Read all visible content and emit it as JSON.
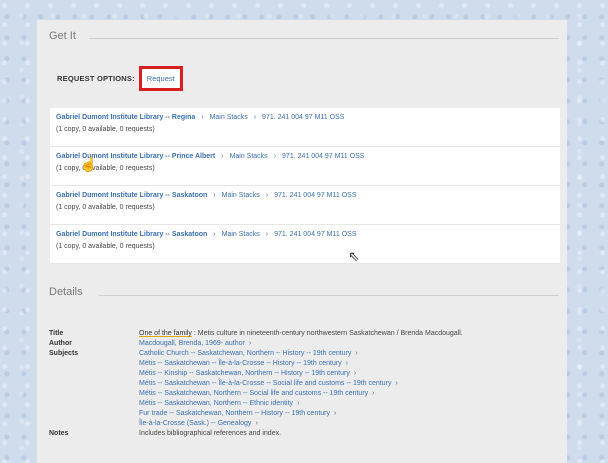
{
  "getit": {
    "heading": "Get It",
    "request_options_label": "REQUEST OPTIONS:",
    "request_button": "Request",
    "separator": "›",
    "holdings": [
      {
        "library": "Gabriel Dumont Institute Library -- Regina",
        "location": "Main Stacks",
        "call_number": "971. 241 004 97 M11 OSS",
        "availability": "(1 copy, 0 available, 0 requests)"
      },
      {
        "library": "Gabriel Dumont Institute Library -- Prince Albert",
        "location": "Main Stacks",
        "call_number": "971. 241 004 97 M11 OSS",
        "availability": "(1 copy, 0 available, 0 requests)"
      },
      {
        "library": "Gabriel Dumont Institute Library -- Saskatoon",
        "location": "Main Stacks",
        "call_number": "971. 241 004 97 M11 OSS",
        "availability": "(1 copy, 0 available, 0 requests)"
      },
      {
        "library": "Gabriel Dumont Institute Library -- Saskatoon",
        "location": "Main Stacks",
        "call_number": "971. 241 004 97 M11 OSS",
        "availability": "(1 copy, 0 available, 0 requests)"
      }
    ]
  },
  "details": {
    "heading": "Details",
    "title_label": "Title",
    "title_link": "One of the family",
    "title_rest": " : Metis culture in nineteenth-century northwestern Saskatchewan / Brenda Macdougall.",
    "author_label": "Author",
    "author_value": "Macdougall, Brenda, 1969- author",
    "subjects_label": "Subjects",
    "subjects": [
      "Catholic Church -- Saskatchewan, Northern -- History -- 19th century",
      "Métis -- Saskatchewan -- Île-à-la-Crosse -- History -- 19th century",
      "Métis -- Kinship -- Saskatchewan, Northern -- History -- 19th century",
      "Métis -- Saskatchewan -- Île-à-la-Crosse -- Social life and customs -- 19th century",
      "Métis -- Saskatchewan, Northern -- Social life and customs -- 19th century",
      "Métis -- Saskatchewan, Northern -- Ethnic identity",
      "Fur trade -- Saskatchewan, Northern -- History -- 19th century",
      "Île-à-la-Crosse (Sask.) -- Genealogy"
    ],
    "notes_label": "Notes",
    "notes_value": "Includes bibliographical references and index."
  }
}
